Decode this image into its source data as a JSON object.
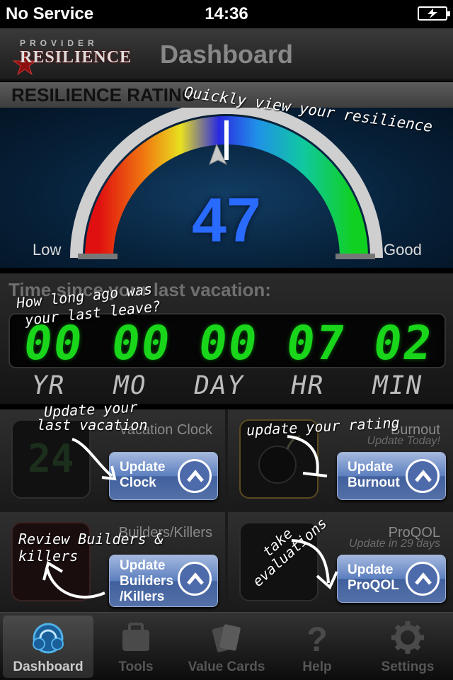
{
  "status_bar": {
    "carrier": "No Service",
    "time": "14:36"
  },
  "nav_bar": {
    "title": "Dashboard",
    "logo_top": "PROVIDER",
    "logo_main": "RESILIENCE"
  },
  "rating": {
    "header": "RESILIENCE RATING",
    "value": "47",
    "value_fraction": 0.47,
    "low_label": "Low",
    "good_label": "Good"
  },
  "vacation": {
    "title": "Time since your last vacation:",
    "digits": [
      "00",
      "00",
      "00",
      "07",
      "02"
    ],
    "units": [
      "YR",
      "MO",
      "DAY",
      "HR",
      "MIN"
    ]
  },
  "tiles": [
    {
      "title": "Vacation Clock",
      "subtitle": "",
      "button_lines": [
        "Update",
        "Clock"
      ],
      "icon": "clock-24-icon"
    },
    {
      "title": "Burnout",
      "subtitle": "Update Today!",
      "button_lines": [
        "Update",
        "Burnout"
      ],
      "icon": "bomb-icon"
    },
    {
      "title": "Builders/Killers",
      "subtitle": "",
      "button_lines": [
        "Update",
        "Builders",
        "/Killers"
      ],
      "icon": "builders-killers-icon"
    },
    {
      "title": "ProQOL",
      "subtitle": "Update in 29 days",
      "button_lines": [
        "Update",
        "ProQOL"
      ],
      "icon": "proqol-icon"
    }
  ],
  "tab_bar": {
    "items": [
      {
        "label": "Dashboard",
        "icon": "dashboard-icon",
        "active": true
      },
      {
        "label": "Tools",
        "icon": "toolbox-icon",
        "active": false
      },
      {
        "label": "Value Cards",
        "icon": "cards-icon",
        "active": false
      },
      {
        "label": "Help",
        "icon": "question-icon",
        "active": false
      },
      {
        "label": "Settings",
        "icon": "gear-icon",
        "active": false
      }
    ]
  },
  "hints": {
    "rating": "Quickly view your resilience",
    "vacation_line1": "How long ago was",
    "vacation_line2": "your last leave?",
    "clock_line1": "Update your",
    "clock_line2": "last vacation",
    "burnout": "update your rating",
    "builders": "Review Builders & killers",
    "proqol_line1": "take",
    "proqol_line2": "evaluations"
  },
  "colors": {
    "lcd_green": "#19d61b",
    "value_blue": "#2a6bff",
    "button_blue": "#5c7fbf"
  }
}
